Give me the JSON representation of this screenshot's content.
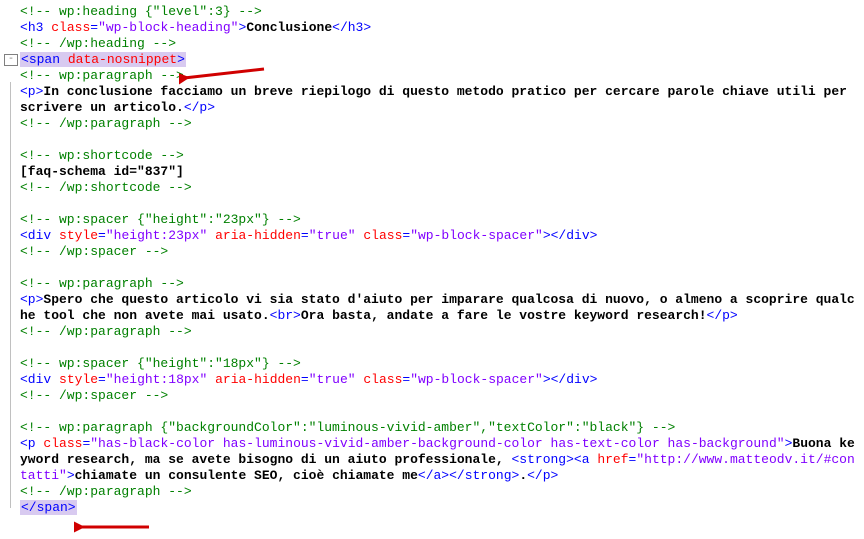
{
  "lines": {
    "c1": "<!-- wp:heading {\"level\":3} -->",
    "h3_open": "h3",
    "h3_class_attr": "class",
    "h3_class_val": "\"wp-block-heading\"",
    "h3_text": "Conclusione",
    "c2": "<!-- /wp:heading -->",
    "span_open": "span",
    "span_attr": "data-nosnippet",
    "c3": "<!-- wp:paragraph -->",
    "p1_text1": "In conclusione facciamo un breve riepilogo di questo metodo pratico per cercare parole chiave utili per scrivere un articolo.",
    "c4": "<!-- /wp:paragraph -->",
    "c5": "<!-- wp:shortcode -->",
    "shortcode": "[faq-schema id=\"837\"]",
    "c6": "<!-- /wp:shortcode -->",
    "c7": "<!-- wp:spacer {\"height\":\"23px\"} -->",
    "div1_style_attr": "style",
    "div1_style_val": "\"height:23px\"",
    "div1_aria_attr": "aria-hidden",
    "div1_aria_val": "\"true\"",
    "div1_class_attr": "class",
    "div1_class_val": "\"wp-block-spacer\"",
    "c8": "<!-- /wp:spacer -->",
    "c9": "<!-- wp:paragraph -->",
    "p2_text": "Spero che questo articolo vi sia stato d'aiuto per imparare qualcosa di nuovo, o almeno a scoprire qualche tool che non avete mai usato.",
    "p2_text_b": "Ora basta, andate a fare le vostre keyword research!",
    "c10": "<!-- /wp:paragraph -->",
    "c11": "<!-- wp:spacer {\"height\":\"18px\"} -->",
    "div2_style_val": "\"height:18px\"",
    "c12": "<!-- /wp:spacer -->",
    "c13": "<!-- wp:paragraph {\"backgroundColor\":\"luminous-vivid-amber\",\"textColor\":\"black\"} -->",
    "p3_class_val": "\"has-black-color has-luminous-vivid-amber-background-color has-text-color has-background\"",
    "p3_text_a": "Buona keyword research, ma se avete bisogno di un aiuto professionale, ",
    "a_href_attr": "href",
    "a_href_val": "\"http://www.matteodv.it/#contatti\"",
    "p3_text_b": "chiamate un consulente SEO, cioè chiamate me",
    "c14": "<!-- /wp:paragraph -->",
    "gutter_collapse": "-"
  }
}
